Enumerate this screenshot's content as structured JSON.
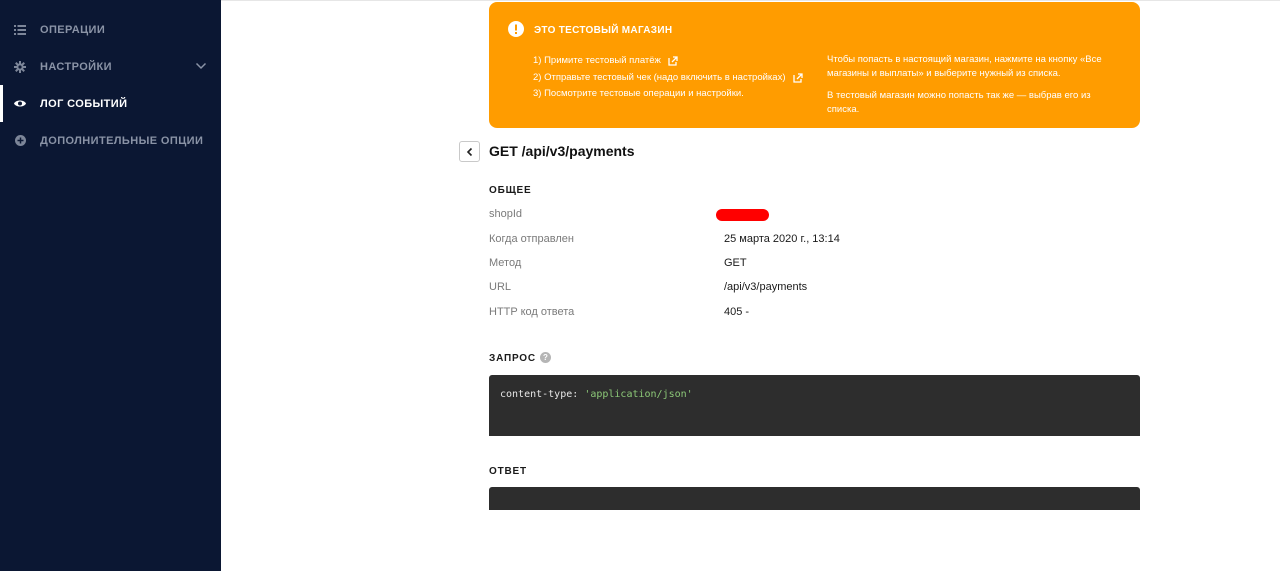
{
  "sidebar": {
    "items": [
      {
        "label": "ОПЕРАЦИИ",
        "icon": "list-icon",
        "active": false
      },
      {
        "label": "НАСТРОЙКИ",
        "icon": "gear-icon",
        "active": false,
        "expandable": true
      },
      {
        "label": "ЛОГ СОБЫТИЙ",
        "icon": "eye-icon",
        "active": true
      },
      {
        "label": "ДОПОЛНИТЕЛЬНЫЕ ОПЦИИ",
        "icon": "plus-circle-icon",
        "active": false
      }
    ]
  },
  "banner": {
    "title": "ЭТО ТЕСТОВЫЙ МАГАЗИН",
    "steps": [
      "1) Примите тестовый платёж",
      "2) Отправьте тестовый чек (надо включить в настройках)",
      "3) Посмотрите тестовые операции и настройки."
    ],
    "info_1": "Чтобы попасть в настоящий магазин, нажмите на кнопку «Все магазины и выплаты» и выберите нужный из списка.",
    "info_2": "В тестовый магазин можно попасть так же — выбрав его из списка.",
    "color": "#ff9c00"
  },
  "page": {
    "title": "GET /api/v3/payments"
  },
  "general": {
    "title": "ОБЩЕЕ",
    "rows": [
      {
        "label": "shopId",
        "value": ""
      },
      {
        "label": "Когда отправлен",
        "value": "25 марта 2020 г., 13:14"
      },
      {
        "label": "Метод",
        "value": "GET"
      },
      {
        "label": "URL",
        "value": "/api/v3/payments"
      },
      {
        "label": "HTTP код ответа",
        "value": "405 -"
      }
    ]
  },
  "request": {
    "title": "ЗАПРОС",
    "help": "?",
    "code_key": "content-type:",
    "code_value": "'application/json'"
  },
  "response": {
    "title": "ОТВЕТ"
  },
  "colors": {
    "sidebar_bg": "#0b1733",
    "code_bg": "#2d2d2d",
    "code_string": "#8cc878",
    "redaction": "#ff0000"
  }
}
